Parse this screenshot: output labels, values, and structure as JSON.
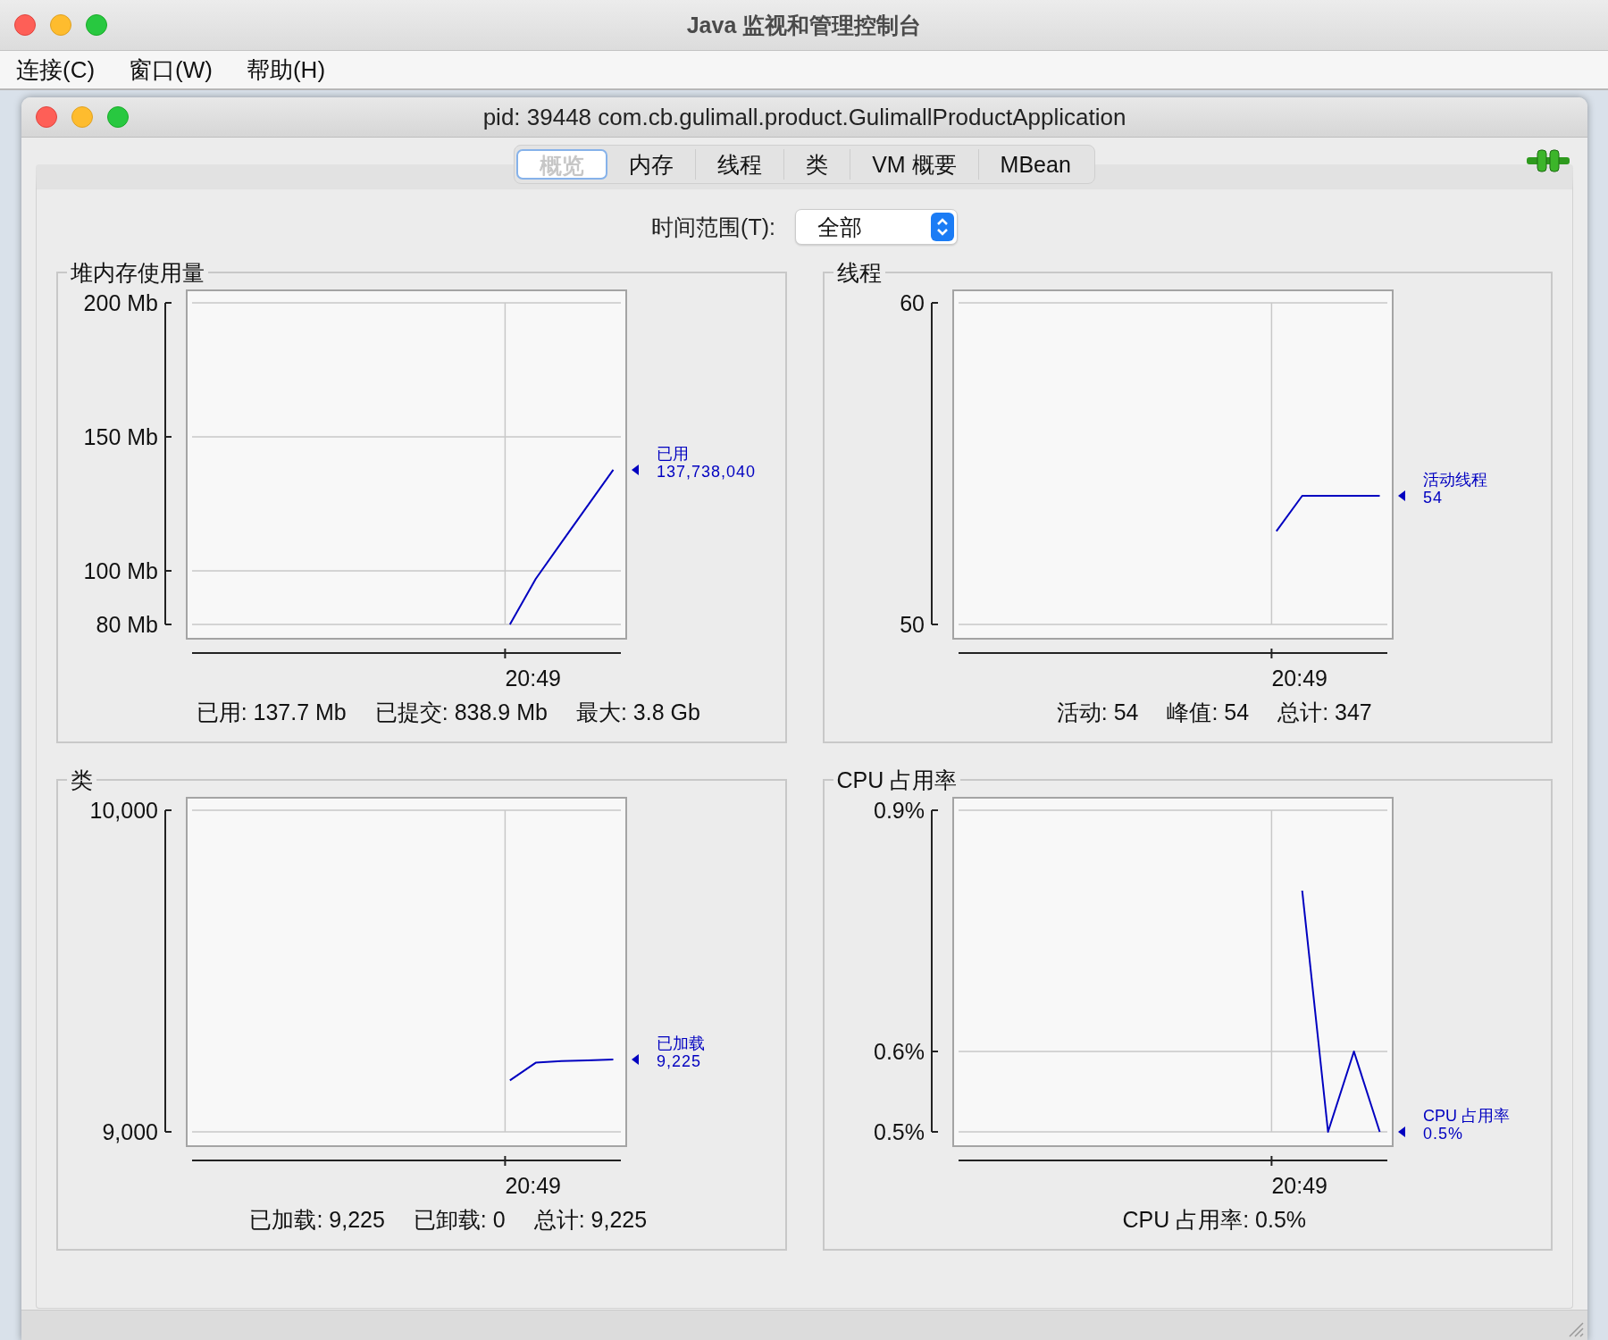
{
  "window": {
    "title": "Java 监视和管理控制台"
  },
  "menu": [
    "连接(C)",
    "窗口(W)",
    "帮助(H)"
  ],
  "inner_window": {
    "title": "pid: 39448 com.cb.gulimall.product.GulimallProductApplication"
  },
  "tabs": [
    {
      "label": "概览",
      "selected": true
    },
    {
      "label": "内存",
      "selected": false
    },
    {
      "label": "线程",
      "selected": false
    },
    {
      "label": "类",
      "selected": false
    },
    {
      "label": "VM 概要",
      "selected": false
    },
    {
      "label": "MBean",
      "selected": false
    }
  ],
  "time_range": {
    "label": "时间范围(T):",
    "value": "全部"
  },
  "panels": [
    {
      "title": "堆内存使用量",
      "legend_value": "137,738,040",
      "stats": [
        "已用: 137.7 Mb",
        "已提交: 838.9 Mb",
        "最大: 3.8 Gb"
      ],
      "chart_data": {
        "type": "line",
        "ylim": [
          80,
          200
        ],
        "annotations": [
          "20:49"
        ],
        "yticks": [
          {
            "value": 200,
            "label": "200 Mb"
          },
          {
            "value": 150,
            "label": "150 Mb"
          },
          {
            "value": 100,
            "label": "100 Mb"
          },
          {
            "value": 80,
            "label": "80 Mb"
          }
        ],
        "series": [
          {
            "name": "已用",
            "color": "#0000c0",
            "values": [
              null,
              null,
              null,
              null,
              null,
              null,
              null,
              null,
              null,
              null,
              null,
              null,
              80,
              97,
              110.6,
              124.2,
              137.7
            ]
          }
        ]
      }
    },
    {
      "title": "线程",
      "legend_value": "54",
      "stats": [
        "活动: 54",
        "峰值: 54",
        "总计: 347"
      ],
      "chart_data": {
        "type": "line",
        "ylim": [
          50,
          60
        ],
        "annotations": [
          "20:49"
        ],
        "yticks": [
          {
            "value": 60,
            "label": "60"
          },
          {
            "value": 50,
            "label": "50"
          }
        ],
        "series": [
          {
            "name": "活动线程",
            "color": "#0000c0",
            "values": [
              null,
              null,
              null,
              null,
              null,
              null,
              null,
              null,
              null,
              null,
              null,
              null,
              52.9,
              54,
              54,
              54,
              54
            ]
          }
        ]
      }
    },
    {
      "title": "类",
      "legend_value": "9,225",
      "stats": [
        "已加载: 9,225",
        "已卸载: 0",
        "总计: 9,225"
      ],
      "chart_data": {
        "type": "line",
        "ylim": [
          9000,
          10000
        ],
        "annotations": [
          "20:49"
        ],
        "yticks": [
          {
            "value": 10000,
            "label": "10,000"
          },
          {
            "value": 9000,
            "label": "9,000"
          }
        ],
        "series": [
          {
            "name": "已加载",
            "color": "#0000c0",
            "values": [
              null,
              null,
              null,
              null,
              null,
              null,
              null,
              null,
              null,
              null,
              null,
              null,
              9160,
              9215,
              9220,
              9222,
              9225
            ]
          }
        ]
      }
    },
    {
      "title": "CPU 占用率",
      "legend_value": "0.5%",
      "stats": [
        "CPU 占用率: 0.5%"
      ],
      "chart_data": {
        "type": "line",
        "ylim": [
          0.5,
          0.9
        ],
        "annotations": [
          "20:49"
        ],
        "yticks": [
          {
            "value": 0.9,
            "label": "0.9%"
          },
          {
            "value": 0.6,
            "label": "0.6%"
          },
          {
            "value": 0.5,
            "label": "0.5%"
          }
        ],
        "series": [
          {
            "name": "CPU 占用率",
            "color": "#0000c0",
            "values": [
              null,
              null,
              null,
              null,
              null,
              null,
              null,
              null,
              null,
              null,
              null,
              null,
              null,
              0.8,
              0.5,
              0.6,
              0.5
            ]
          }
        ]
      }
    }
  ]
}
